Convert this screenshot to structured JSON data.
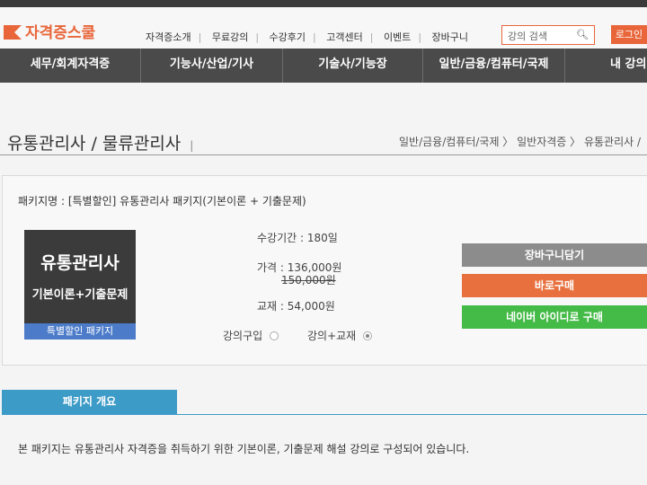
{
  "header": {
    "logo_text": "자격증스쿨",
    "nav": [
      "자격증소개",
      "무료강의",
      "수강후기",
      "고객센터",
      "이벤트",
      "장바구니"
    ],
    "search_placeholder": "강의 검색",
    "login_label": "로그인"
  },
  "menu": [
    "세무/회계자격증",
    "기능사/산업/기사",
    "기술사/기능장",
    "일반/금융/컴퓨터/국제",
    "내 강의"
  ],
  "page": {
    "title": "유통관리사 / 물류관리사",
    "breadcrumb": "일반/금융/컴퓨터/국제 〉 일반자격증 〉 유통관리사 /"
  },
  "package": {
    "name_label": "패키지명 : [특별할인] 유통관리사 패키지(기본이론 + 기출문제)",
    "cover": {
      "title": "유통관리사",
      "subtitle": "기본이론+기출문제",
      "badge": "특별할인 패키지"
    },
    "period": "수강기간 : 180일",
    "price": "가격 : 136,000원",
    "original_price": "150,000원",
    "textbook": "교재 : 54,000원",
    "option_lecture": "강의구입",
    "option_lecture_textbook": "강의+교재",
    "selected_option": "강의+교재"
  },
  "buttons": {
    "cart": "장바구니담기",
    "buy": "바로구매",
    "naver": "네이버 아이디로 구매"
  },
  "colors": {
    "accent": "#e8663a",
    "menu_bg": "#4a4a4a",
    "cart_btn": "#8c8c8c",
    "buy_btn": "#e8703f",
    "naver_btn": "#45bb47",
    "tab": "#3d9bc7",
    "cover_badge": "#4b7bc9"
  },
  "overview": {
    "tab_label": "패키지 개요",
    "description": "본 패키지는 유통관리사 자격증을 취득하기 위한 기본이론, 기출문제 해설 강의로 구성되어 있습니다."
  }
}
